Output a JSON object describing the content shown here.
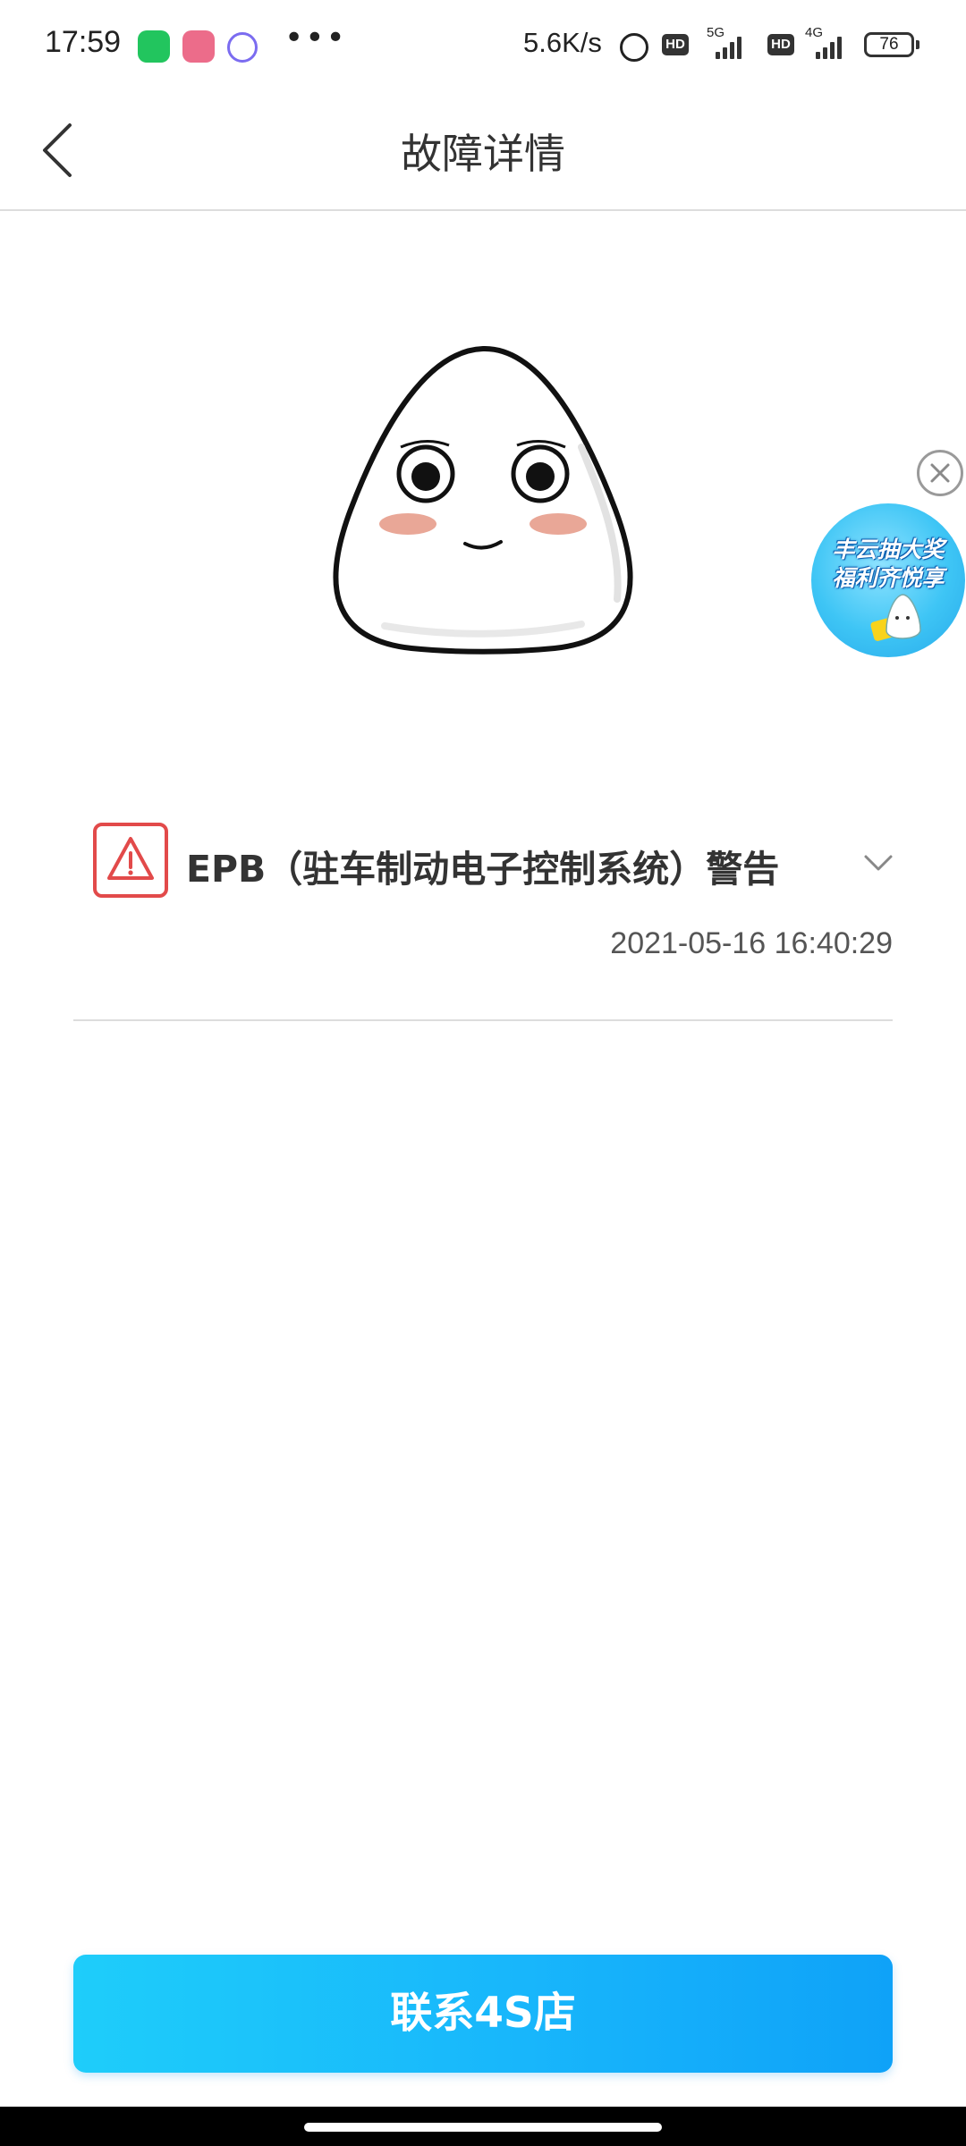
{
  "status_bar": {
    "time": "17:59",
    "more": "•••",
    "network_speed": "5.6K/s",
    "hd_1": "HD",
    "gen_1": "5G",
    "hd_2": "HD",
    "gen_2": "4G",
    "battery": "76",
    "icons": [
      "wechat-icon",
      "avatar-app-icon",
      "qq-icon",
      "alarm-icon",
      "signal-icon",
      "battery-icon"
    ]
  },
  "header": {
    "title": "故障详情",
    "back_icon": "chevron-left-icon"
  },
  "promo": {
    "text_line1": "丰云抽大奖",
    "text_line2": "福利齐悦享",
    "close_icon": "close-icon"
  },
  "fault": {
    "title": "EPB（驻车制动电子控制系统）警告",
    "time": "2021-05-16 16:40:29",
    "icon": "warning-icon",
    "expand_icon": "chevron-down-icon",
    "warning_color": "#e24a4a"
  },
  "cta": {
    "label": "联系4S店",
    "color": "#18b6fb"
  }
}
